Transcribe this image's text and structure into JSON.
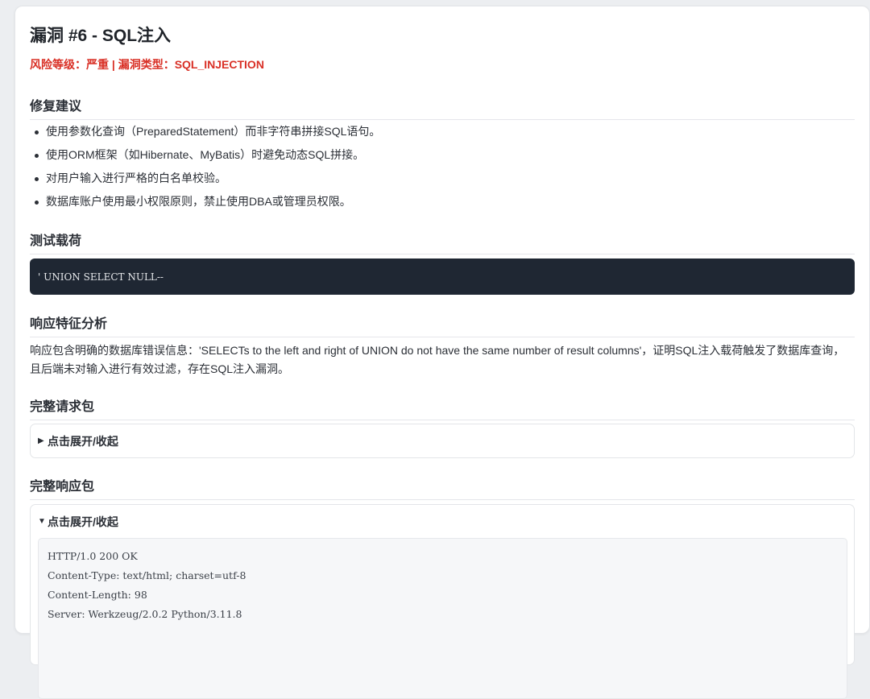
{
  "vuln": {
    "title": "漏洞 #6 - SQL注入",
    "risk_line": "风险等级：严重 | 漏洞类型：SQL_INJECTION"
  },
  "sections": {
    "fix": {
      "heading": "修复建议",
      "items": [
        "使用参数化查询（PreparedStatement）而非字符串拼接SQL语句。",
        "使用ORM框架（如Hibernate、MyBatis）时避免动态SQL拼接。",
        "对用户输入进行严格的白名单校验。",
        "数据库账户使用最小权限原则，禁止使用DBA或管理员权限。"
      ]
    },
    "payload": {
      "heading": "测试载荷",
      "code": "' UNION SELECT NULL--"
    },
    "analysis": {
      "heading": "响应特征分析",
      "text": "响应包含明确的数据库错误信息：'SELECTs to the left and right of UNION do not have the same number of result columns'，证明SQL注入载荷触发了数据库查询，且后端未对输入进行有效过滤，存在SQL注入漏洞。"
    },
    "request": {
      "heading": "完整请求包",
      "toggle_label": "点击展开/收起",
      "expanded": false
    },
    "response": {
      "heading": "完整响应包",
      "toggle_label": "点击展开/收起",
      "expanded": true,
      "lines": [
        "HTTP/1.0 200 OK",
        "Content-Type: text/html; charset=utf-8",
        "Content-Length: 98",
        "Server: Werkzeug/2.0.2 Python/3.11.8"
      ]
    }
  },
  "icons": {
    "collapsed": "triangle-right-icon",
    "expanded": "triangle-down-icon"
  },
  "colors": {
    "risk": "#d93026",
    "code_bg": "#1f2733"
  }
}
